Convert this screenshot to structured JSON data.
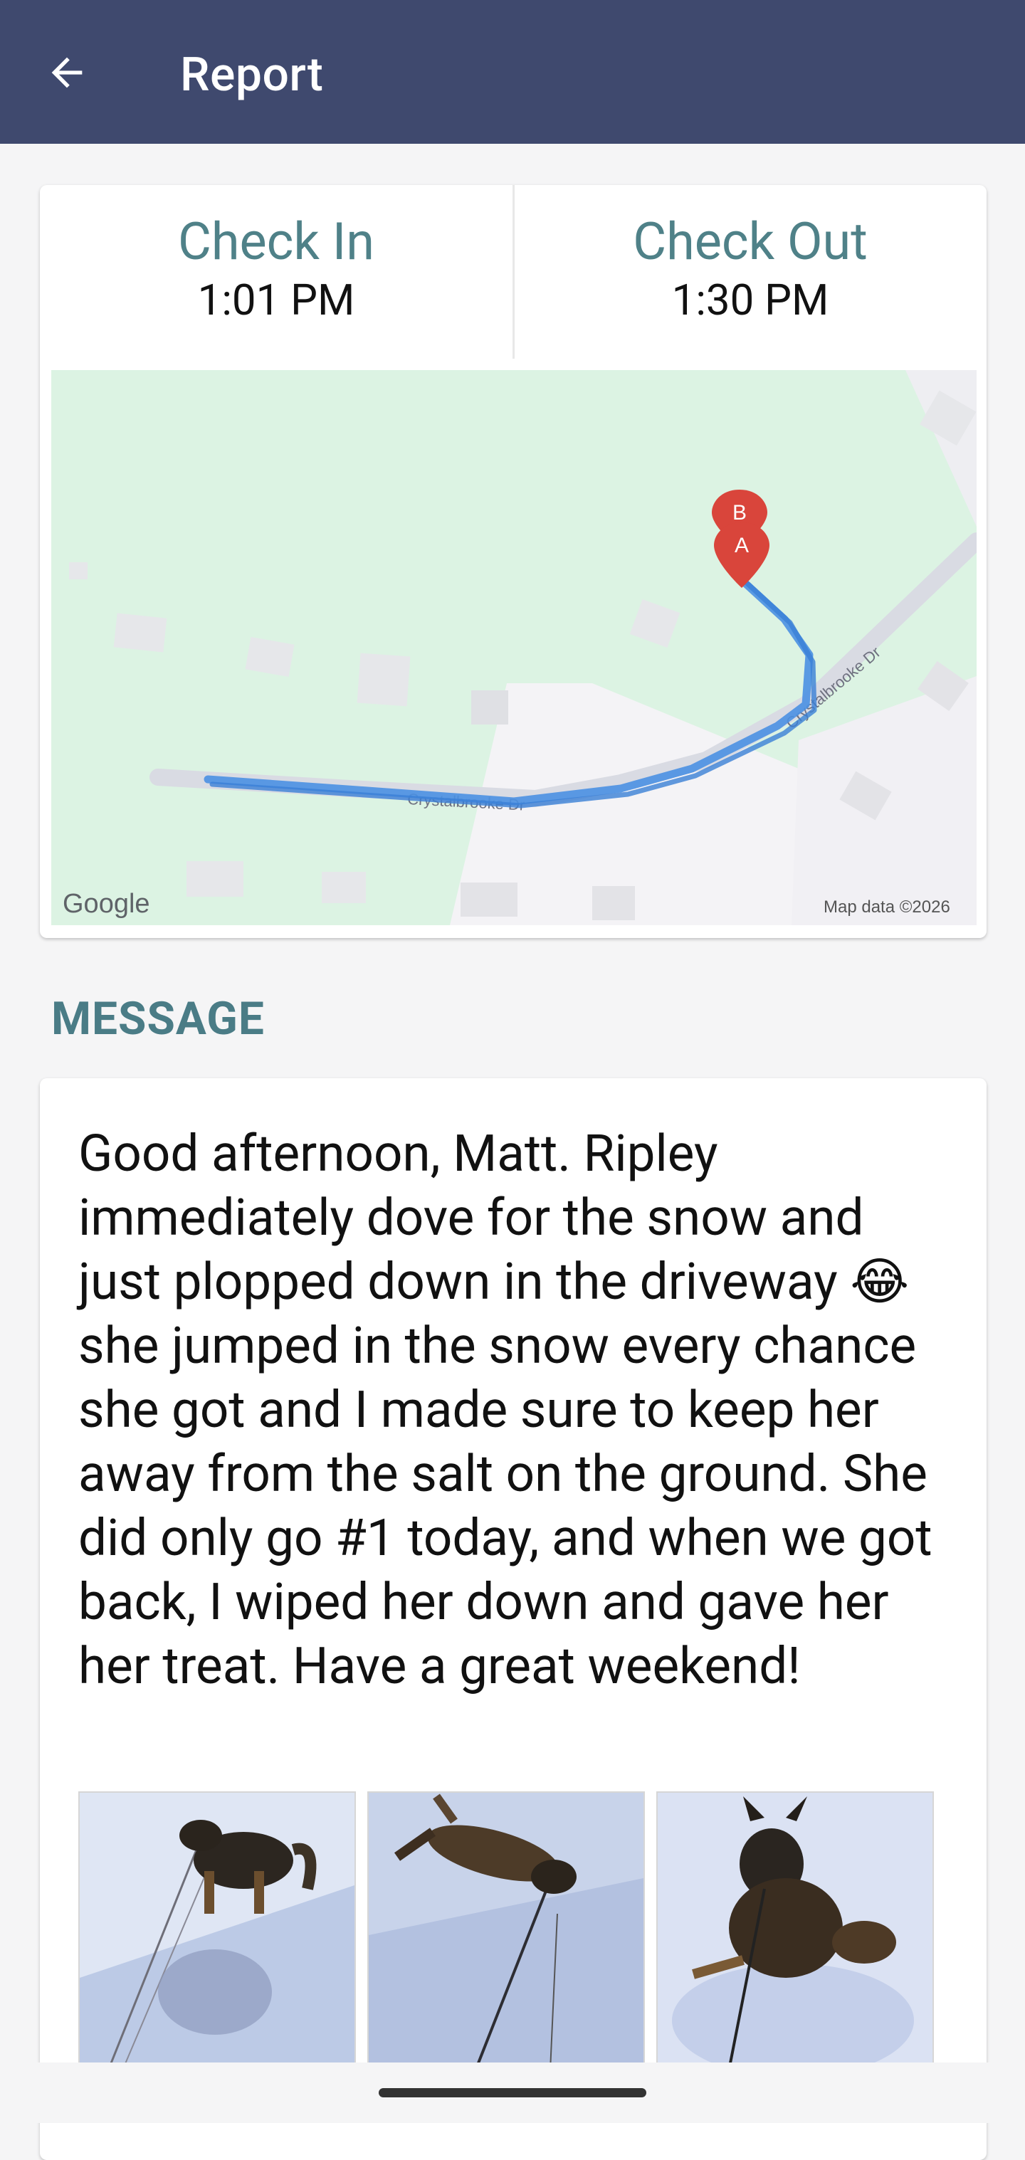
{
  "header": {
    "title": "Report",
    "back_icon": "arrow-left-icon",
    "background": "#3f496e"
  },
  "times": {
    "check_in_label": "Check In",
    "check_in_time": "1:01 PM",
    "check_out_label": "Check Out",
    "check_out_time": "1:30 PM",
    "label_color": "#4f8188"
  },
  "map": {
    "street_name_diagonal": "Crystalbrooke Dr",
    "street_name_bottom": "Crystalbrooke Dr",
    "marker_b": "B",
    "marker_a": "A",
    "logo": "Google",
    "attribution": "Map data ©2026",
    "route_color": "#4a90e2",
    "marker_color": "#d9453b"
  },
  "message": {
    "section_label": "MESSAGE",
    "text": "Good afternoon, Matt. Ripley immediately dove for the snow and just plopped down in the driveway 😂 she jumped in the snow every chance she got and I made sure to keep her away from the salt on the ground. She did only go #1 today, and when we got back, I wiped her down and gave her her treat. Have a great weekend!",
    "photos": [
      "dog-standing-in-snow-photo",
      "dog-lying-in-snow-photo",
      "dog-sitting-in-snow-photo"
    ]
  }
}
